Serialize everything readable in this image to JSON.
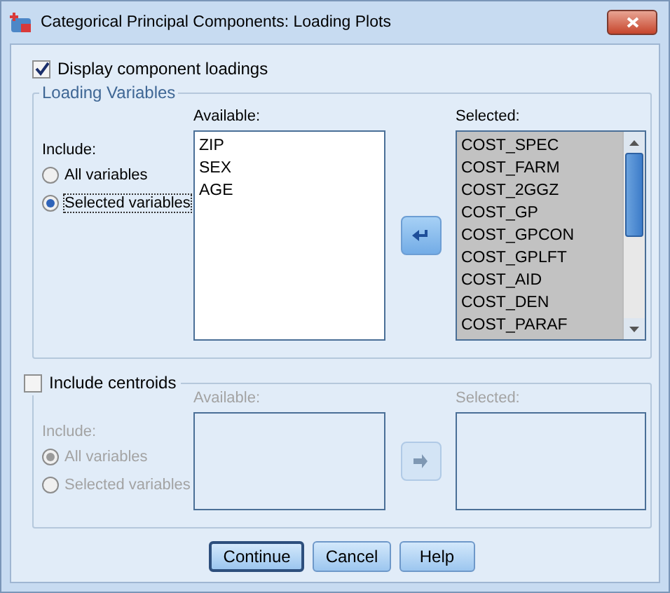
{
  "window": {
    "title": "Categorical Principal Components: Loading Plots"
  },
  "display_loadings": {
    "label": "Display component loadings",
    "checked": true
  },
  "loading_variables": {
    "title": "Loading Variables",
    "disabled": false,
    "include_label": "Include:",
    "radios": [
      {
        "label": "All variables",
        "selected": false
      },
      {
        "label": "Selected variables",
        "selected": true
      }
    ],
    "available": {
      "label": "Available:",
      "items": [
        "ZIP",
        "SEX",
        "AGE"
      ]
    },
    "selected": {
      "label": "Selected:",
      "items": [
        "COST_SPEC",
        "COST_FARM",
        "COST_2GGZ",
        "COST_GP",
        "COST_GPCON",
        "COST_GPLFT",
        "COST_AID",
        "COST_DEN",
        "COST_PARAF"
      ]
    }
  },
  "centroids": {
    "label": "Include centroids",
    "checked": false,
    "disabled": true,
    "include_label": "Include:",
    "radios": [
      {
        "label": "All variables",
        "selected": true
      },
      {
        "label": "Selected variables",
        "selected": false
      }
    ],
    "available": {
      "label": "Available:"
    },
    "selected": {
      "label": "Selected:"
    }
  },
  "buttons": [
    {
      "label": "Continue",
      "default": true
    },
    {
      "label": "Cancel",
      "default": false
    },
    {
      "label": "Help",
      "default": false
    }
  ]
}
